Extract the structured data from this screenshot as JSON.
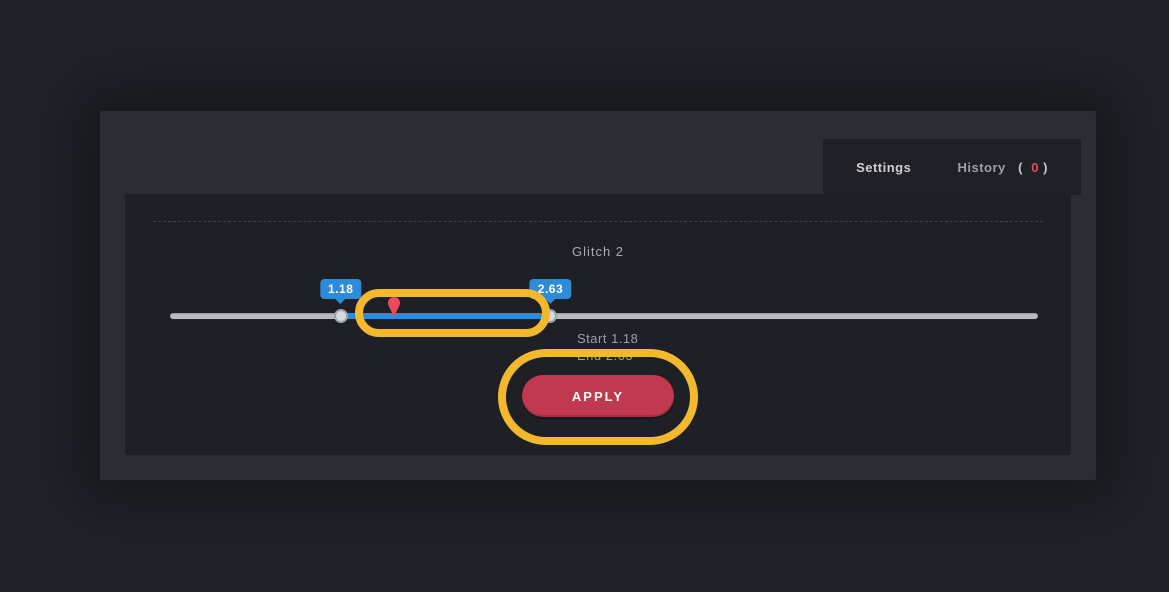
{
  "tabs": {
    "settings_label": "Settings",
    "history_label": "History",
    "history_count": "0"
  },
  "panel": {
    "title": "Glitch 2"
  },
  "slider": {
    "min": 0,
    "max": 6,
    "start_value": 1.18,
    "end_value": 2.63,
    "playhead_value": 1.55,
    "start_tooltip": "1.18",
    "end_tooltip": "2.63"
  },
  "values": {
    "start_label": "Start 1.18",
    "end_label": "End 2.63"
  },
  "buttons": {
    "apply_label": "APPLY"
  },
  "colors": {
    "accent_blue": "#2e8bd8",
    "accent_red": "#c0394e",
    "highlight_yellow": "#f3b92e"
  }
}
